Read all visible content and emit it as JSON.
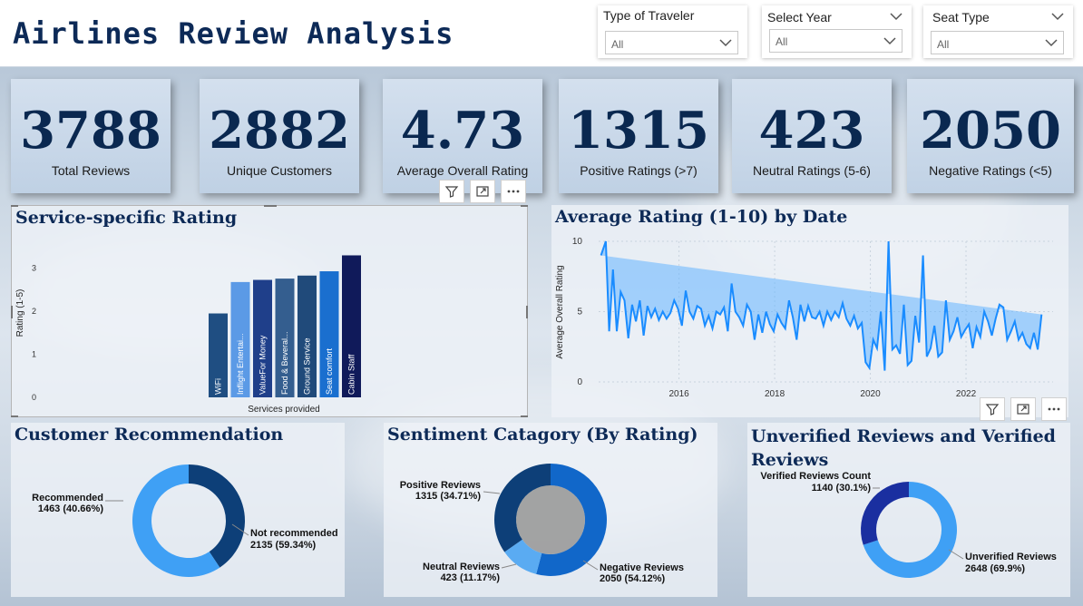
{
  "title": "Airlines Review Analysis",
  "slicers": [
    {
      "label": "Type of Traveler",
      "value": "All"
    },
    {
      "label": "Select Year",
      "value": "All"
    },
    {
      "label": "Seat Type",
      "value": "All"
    }
  ],
  "kpis": [
    {
      "value": "3788",
      "label": "Total Reviews"
    },
    {
      "value": "2882",
      "label": "Unique Customers"
    },
    {
      "value": "4.73",
      "label": "Average Overall Rating"
    },
    {
      "value": "1315",
      "label": "Positive Ratings (>7)"
    },
    {
      "value": "423",
      "label": "Neutral  Ratings (5-6)"
    },
    {
      "value": "2050",
      "label": "Negative Ratings (<5)"
    }
  ],
  "panels": {
    "service": "Service-specific Rating",
    "date": "Average Rating (1-10) by Date",
    "recommend": "Customer Recommendation",
    "sentiment": "Sentiment Catagory (By Rating)",
    "verified": "Unverified Reviews and Verified Reviews"
  },
  "colors": {
    "title": "#0d2a57",
    "line": "#1a8cff",
    "area": "#64b4ff",
    "donut_dark": "#0d3f78",
    "donut_light": "#3fa0f5",
    "donut_mid": "#1167c9",
    "donut_navy": "#1a2fa0"
  },
  "chart_data": [
    {
      "type": "bar",
      "title": "Service-specific Rating",
      "xlabel": "Services provided",
      "ylabel": "Rating (1-5)",
      "ylim": [
        0,
        3.5
      ],
      "yticks": [
        0,
        1,
        2,
        3
      ],
      "categories": [
        "WiFi",
        "Inflight Entertai...",
        "ValueFor Money",
        "Food & Beveral...",
        "Ground Service",
        "Seat comfort",
        "Cabin Staff"
      ],
      "values": [
        1.95,
        2.68,
        2.73,
        2.76,
        2.83,
        2.93,
        3.3
      ],
      "colors": [
        "#1f4e82",
        "#5b9ae6",
        "#1f3f8a",
        "#345e8f",
        "#204a7a",
        "#1a6fcf",
        "#101a5a"
      ]
    },
    {
      "type": "area",
      "title": "Average Rating (1-10) by Date",
      "xlabel": "",
      "ylabel": "Average Overall Rating",
      "ylim": [
        0,
        10
      ],
      "yticks": [
        0,
        5,
        10
      ],
      "xlim": [
        2014.4,
        2023.9
      ],
      "xticks": [
        "2016",
        "2018",
        "2020",
        "2022"
      ],
      "x": [
        2014.45,
        2014.55,
        2014.62,
        2014.7,
        2014.78,
        2014.86,
        2014.94,
        2015.02,
        2015.1,
        2015.18,
        2015.26,
        2015.34,
        2015.42,
        2015.5,
        2015.58,
        2015.66,
        2015.74,
        2015.82,
        2015.9,
        2015.98,
        2016.06,
        2016.14,
        2016.22,
        2016.3,
        2016.38,
        2016.46,
        2016.54,
        2016.62,
        2016.7,
        2016.78,
        2016.86,
        2016.94,
        2017.02,
        2017.1,
        2017.18,
        2017.26,
        2017.34,
        2017.42,
        2017.5,
        2017.58,
        2017.66,
        2017.74,
        2017.82,
        2017.9,
        2017.98,
        2018.06,
        2018.14,
        2018.22,
        2018.3,
        2018.38,
        2018.46,
        2018.54,
        2018.62,
        2018.7,
        2018.78,
        2018.86,
        2018.94,
        2019.02,
        2019.1,
        2019.18,
        2019.26,
        2019.34,
        2019.42,
        2019.5,
        2019.58,
        2019.66,
        2019.74,
        2019.82,
        2019.9,
        2019.98,
        2020.06,
        2020.14,
        2020.22,
        2020.3,
        2020.38,
        2020.46,
        2020.54,
        2020.62,
        2020.7,
        2020.78,
        2020.86,
        2020.94,
        2021.02,
        2021.1,
        2021.18,
        2021.26,
        2021.34,
        2021.42,
        2021.5,
        2021.58,
        2021.66,
        2021.74,
        2021.82,
        2021.9,
        2021.98,
        2022.06,
        2022.14,
        2022.22,
        2022.3,
        2022.38,
        2022.46,
        2022.54,
        2022.62,
        2022.7,
        2022.78,
        2022.86,
        2022.94,
        2023.02,
        2023.1,
        2023.18,
        2023.26,
        2023.34,
        2023.42,
        2023.5,
        2023.58,
        2023.66,
        2023.74,
        2023.82
      ],
      "y": [
        9.0,
        10.0,
        3.6,
        8.0,
        3.6,
        6.4,
        5.8,
        3.1,
        5.5,
        4.3,
        5.8,
        3.3,
        5.4,
        4.6,
        5.2,
        4.4,
        5.0,
        4.5,
        4.9,
        5.8,
        5.2,
        4.0,
        6.5,
        5.0,
        4.5,
        5.4,
        5.2,
        4.0,
        4.7,
        3.8,
        5.0,
        4.8,
        5.3,
        3.6,
        7.0,
        5.0,
        4.6,
        4.0,
        5.5,
        5.0,
        3.0,
        4.8,
        3.5,
        5.0,
        4.1,
        3.6,
        4.8,
        4.2,
        3.8,
        5.8,
        4.6,
        3.0,
        5.5,
        4.3,
        5.4,
        4.6,
        4.5,
        5.0,
        4.0,
        5.0,
        4.4,
        5.0,
        4.6,
        5.6,
        4.5,
        4.0,
        4.7,
        3.8,
        4.2,
        1.4,
        1.0,
        3.0,
        2.4,
        5.0,
        0.8,
        10.0,
        2.3,
        2.6,
        2.0,
        5.5,
        1.2,
        1.5,
        4.7,
        2.8,
        9.0,
        1.8,
        2.4,
        4.0,
        1.8,
        2.1,
        5.8,
        3.0,
        3.6,
        4.6,
        3.2,
        3.7,
        4.1,
        2.4,
        3.9,
        3.2,
        5.0,
        4.3,
        3.3,
        4.5,
        5.5,
        5.3,
        3.0,
        3.6,
        4.3,
        3.0,
        3.5,
        2.7,
        2.4,
        3.5,
        2.3,
        4.8
      ]
    },
    {
      "type": "pie",
      "title": "Customer Recommendation",
      "labels": [
        "Recommended",
        "Not recommended"
      ],
      "values": [
        1463,
        2135
      ],
      "display": [
        "1463 (40.66%)",
        "2135 (59.34%)"
      ],
      "colors": [
        "#0d3f78",
        "#3fa0f5"
      ]
    },
    {
      "type": "pie",
      "title": "Sentiment Catagory (By Rating)",
      "labels": [
        "Negative Reviews",
        "Neutral Reviews",
        "Positive Reviews"
      ],
      "values": [
        2050,
        423,
        1315
      ],
      "display": [
        "2050 (54.12%)",
        "423 (11.17%)",
        "1315 (34.71%)"
      ],
      "colors": [
        "#1167c9",
        "#5aabf2",
        "#0d3f78"
      ]
    },
    {
      "type": "pie",
      "title": "Unverified Reviews and Verified Reviews",
      "labels": [
        "Unverified Reviews",
        "Verified Reviews Count"
      ],
      "values": [
        2648,
        1140
      ],
      "display": [
        "2648 (69.9%)",
        "1140 (30.1%)"
      ],
      "colors": [
        "#3fa0f5",
        "#1a2fa0"
      ]
    }
  ]
}
